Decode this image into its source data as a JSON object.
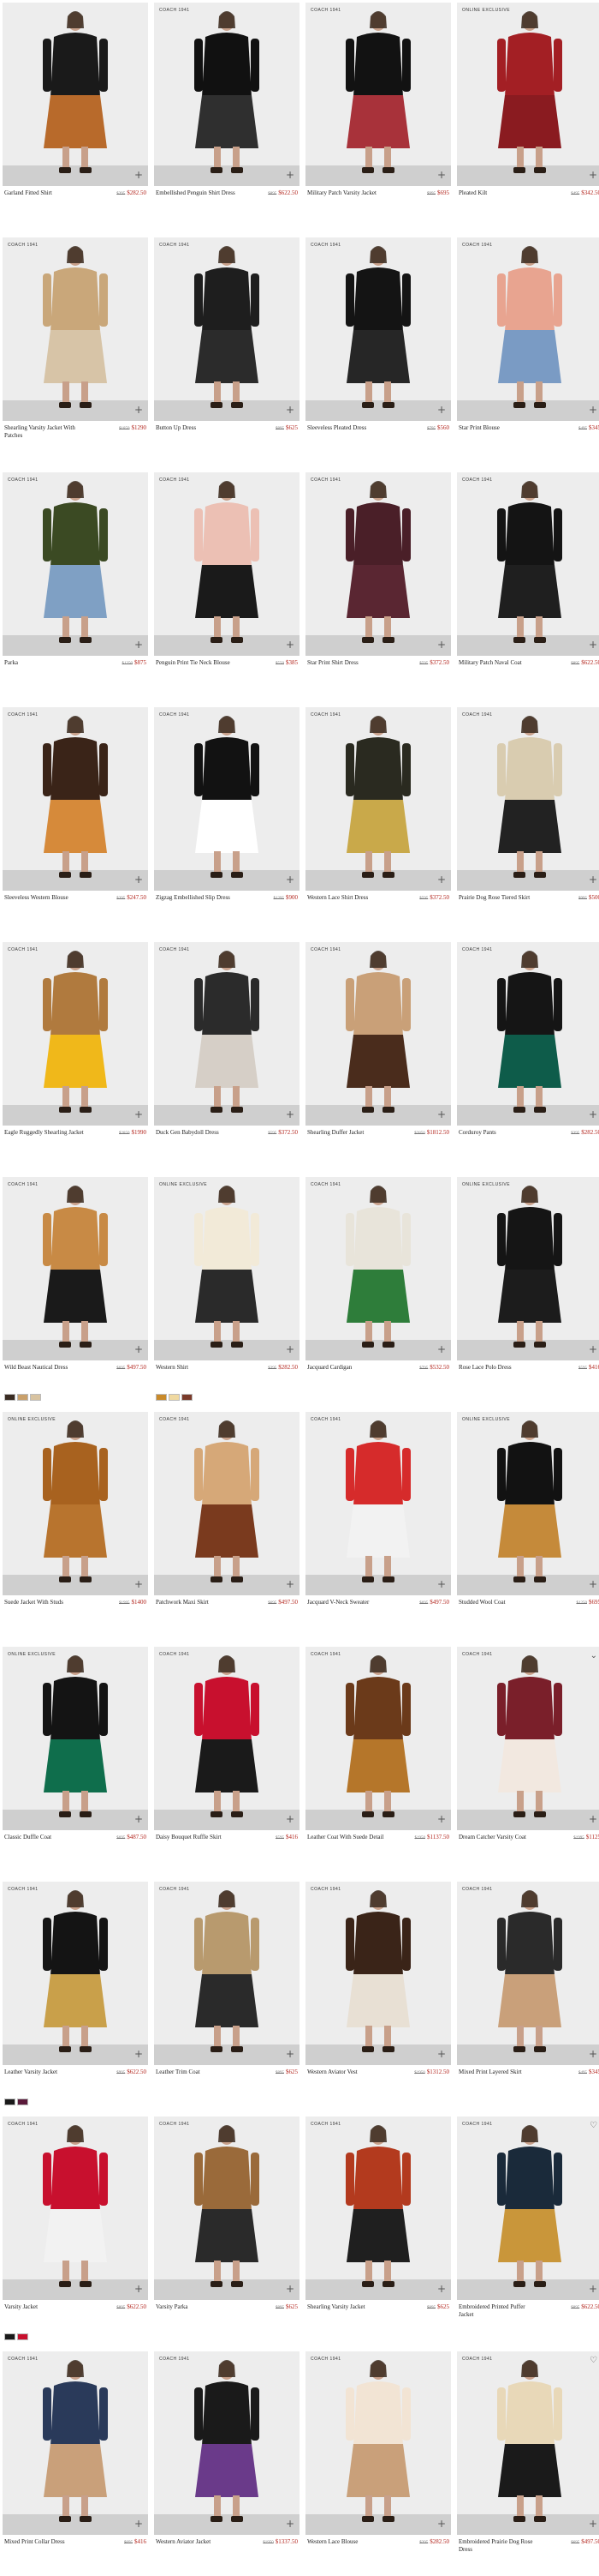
{
  "colors": {
    "sale_price": "#b3261e",
    "image_background": "#ededed",
    "floor": "#cfcfcf"
  },
  "products": [
    {
      "tag": "",
      "name": "Garland Fitted Shirt",
      "was": "$395",
      "now": "$282.50",
      "colors": [
        "#1a1a1a",
        "#b86a2b"
      ],
      "swatches": []
    },
    {
      "tag": "COACH 1941",
      "name": "Embellished Penguin Shirt Dress",
      "was": "$895",
      "now": "$622.50",
      "colors": [
        "#111111",
        "#2f2f2f"
      ],
      "swatches": []
    },
    {
      "tag": "COACH 1941",
      "name": "Military Patch Varsity Jacket",
      "was": "$995",
      "now": "$695",
      "colors": [
        "#121212",
        "#a8323a"
      ],
      "swatches": []
    },
    {
      "tag": "ONLINE EXCLUSIVE",
      "name": "Pleated Kilt",
      "was": "$495",
      "now": "$342.50",
      "colors": [
        "#a31f24",
        "#8a1b20"
      ],
      "swatches": []
    },
    {
      "tag": "COACH 1941",
      "name": "Shearling Varsity Jacket With Patches",
      "was": "$1850",
      "now": "$1290",
      "colors": [
        "#c9a77a",
        "#d7c4a7"
      ],
      "swatches": []
    },
    {
      "tag": "COACH 1941",
      "name": "Button Up Dress",
      "was": "$895",
      "now": "$625",
      "colors": [
        "#1e1e1e",
        "#2b2b2b"
      ],
      "swatches": []
    },
    {
      "tag": "COACH 1941",
      "name": "Sleeveless Pleated Dress",
      "was": "$795",
      "now": "$560",
      "colors": [
        "#141414",
        "#262626"
      ],
      "swatches": []
    },
    {
      "tag": "COACH 1941",
      "name": "Star Print Blouse",
      "was": "$495",
      "now": "$345",
      "colors": [
        "#e8a490",
        "#7a9bc4"
      ],
      "swatches": []
    },
    {
      "tag": "COACH 1941",
      "name": "Parka",
      "was": "$1250",
      "now": "$875",
      "colors": [
        "#3b4a23",
        "#7fa0c4"
      ],
      "swatches": []
    },
    {
      "tag": "COACH 1941",
      "name": "Penguin Print Tie Neck Blouse",
      "was": "$550",
      "now": "$385",
      "colors": [
        "#ecc0b4",
        "#1a1a1a"
      ],
      "swatches": []
    },
    {
      "tag": "COACH 1941",
      "name": "Star Print Shirt Dress",
      "was": "$595",
      "now": "$372.50",
      "colors": [
        "#4a1f28",
        "#5a2632"
      ],
      "swatches": []
    },
    {
      "tag": "COACH 1941",
      "name": "Military Patch Naval Coat",
      "was": "$895",
      "now": "$622.50",
      "colors": [
        "#141414",
        "#1f1f1f"
      ],
      "swatches": []
    },
    {
      "tag": "COACH 1941",
      "name": "Sleeveless Western Blouse",
      "was": "$395",
      "now": "$247.50",
      "colors": [
        "#3a2418",
        "#d68a3a"
      ],
      "swatches": []
    },
    {
      "tag": "COACH 1941",
      "name": "Zigzag Embellished Slip Dress",
      "was": "$1295",
      "now": "$900",
      "colors": [
        "#121212",
        "#ffffff"
      ],
      "swatches": []
    },
    {
      "tag": "COACH 1941",
      "name": "Western Lace Shirt Dress",
      "was": "$595",
      "now": "$372.50",
      "colors": [
        "#2a2a20",
        "#c9a94a"
      ],
      "swatches": []
    },
    {
      "tag": "COACH 1941",
      "name": "Prairie Dog Rose Tiered Skirt",
      "was": "$995",
      "now": "$500",
      "colors": [
        "#d9ccb0",
        "#222222"
      ],
      "swatches": []
    },
    {
      "tag": "COACH 1941",
      "name": "Eagle Ruggedly Shearling Jacket",
      "was": "$2850",
      "now": "$1990",
      "colors": [
        "#b07a3e",
        "#f0b81a"
      ],
      "swatches": []
    },
    {
      "tag": "COACH 1941",
      "name": "Duck Gen Babydoll Dress",
      "was": "$595",
      "now": "$372.50",
      "colors": [
        "#2b2b2b",
        "#d6cfc7"
      ],
      "swatches": []
    },
    {
      "tag": "COACH 1941",
      "name": "Shearling Duffer Jacket",
      "was": "$2850",
      "now": "$1812.50",
      "colors": [
        "#c9a078",
        "#4a2c1c"
      ],
      "swatches": []
    },
    {
      "tag": "COACH 1941",
      "name": "Corduroy Pants",
      "was": "$395",
      "now": "$282.50",
      "colors": [
        "#151515",
        "#0e5c4a"
      ],
      "swatches": []
    },
    {
      "tag": "COACH 1941",
      "name": "Wild Beast Nautical Dress",
      "was": "$695",
      "now": "$497.50",
      "colors": [
        "#c88a45",
        "#1a1a1a"
      ],
      "swatches": [
        "#3a2c22",
        "#c9a06a",
        "#d8c3a0"
      ]
    },
    {
      "tag": "ONLINE EXCLUSIVE",
      "name": "Western Shirt",
      "was": "$395",
      "now": "$282.50",
      "colors": [
        "#f2ead8",
        "#2a2a2a"
      ],
      "swatches": [
        "#c98a2a",
        "#f0d9a0",
        "#7a3a2a"
      ]
    },
    {
      "tag": "COACH 1941",
      "name": "Jacquard Cardigan",
      "was": "$795",
      "now": "$532.50",
      "colors": [
        "#e8e4da",
        "#2e7d3a"
      ],
      "swatches": []
    },
    {
      "tag": "ONLINE EXCLUSIVE",
      "name": "Rose Lace Polo Dress",
      "was": "$595",
      "now": "$416",
      "colors": [
        "#151515",
        "#1c1c1c"
      ],
      "swatches": []
    },
    {
      "tag": "ONLINE EXCLUSIVE",
      "name": "Suede Jacket With Studs",
      "was": "$1995",
      "now": "$1400",
      "colors": [
        "#a8621f",
        "#b8742e"
      ],
      "swatches": []
    },
    {
      "tag": "COACH 1941",
      "name": "Patchwork Maxi Skirt",
      "was": "$695",
      "now": "$497.50",
      "colors": [
        "#d6a878",
        "#7a3a1e"
      ],
      "swatches": []
    },
    {
      "tag": "COACH 1941",
      "name": "Jacquard V-Neck Sweater",
      "was": "$695",
      "now": "$497.50",
      "colors": [
        "#d62b2b",
        "#f2f2f2"
      ],
      "swatches": []
    },
    {
      "tag": "ONLINE EXCLUSIVE",
      "name": "Studded Wool Coat",
      "was": "$1250",
      "now": "$695",
      "colors": [
        "#121212",
        "#c58a3a"
      ],
      "swatches": []
    },
    {
      "tag": "ONLINE EXCLUSIVE",
      "name": "Classic Duffle Coat",
      "was": "$695",
      "now": "$487.50",
      "colors": [
        "#141414",
        "#0f6e4c"
      ],
      "swatches": []
    },
    {
      "tag": "COACH 1941",
      "name": "Daisy Bouquet Ruffle Skirt",
      "was": "$595",
      "now": "$416",
      "colors": [
        "#c8102e",
        "#1a1a1a"
      ],
      "swatches": []
    },
    {
      "tag": "COACH 1941",
      "name": "Leather Coat With Suede Detail",
      "was": "$1950",
      "now": "$1137.50",
      "colors": [
        "#6b3a1a",
        "#b5762a"
      ],
      "swatches": []
    },
    {
      "tag": "COACH 1941",
      "name": "Dream Catcher Varsity Coat",
      "was": "$1995",
      "now": "$1125",
      "colors": [
        "#7a1f2a",
        "#f2e8e0"
      ],
      "swatches": []
    },
    {
      "tag": "COACH 1941",
      "name": "Leather Varsity Jacket",
      "was": "$995",
      "now": "$622.50",
      "colors": [
        "#141414",
        "#c9a04a"
      ],
      "swatches": [
        "#1a1a1a",
        "#5a1a3a"
      ]
    },
    {
      "tag": "COACH 1941",
      "name": "Leather Trim Coat",
      "was": "$895",
      "now": "$625",
      "colors": [
        "#b89a6e",
        "#2a2a2a"
      ],
      "swatches": []
    },
    {
      "tag": "COACH 1941",
      "name": "Western Aviator Vest",
      "was": "$1950",
      "now": "$1312.50",
      "colors": [
        "#3a2418",
        "#e8e0d4"
      ],
      "swatches": []
    },
    {
      "tag": "COACH 1941",
      "name": "Mixed Print Layered Skirt",
      "was": "$495",
      "now": "$345",
      "colors": [
        "#2a2a2a",
        "#c9a07a"
      ],
      "swatches": []
    },
    {
      "tag": "COACH 1941",
      "name": "Varsity Jacket",
      "was": "$895",
      "now": "$622.50",
      "colors": [
        "#c8102e",
        "#f2f2f2"
      ],
      "swatches": [
        "#1a1a1a",
        "#c8102e"
      ]
    },
    {
      "tag": "COACH 1941",
      "name": "Varsity Parka",
      "was": "$895",
      "now": "$625",
      "colors": [
        "#9a6a3a",
        "#2a2a2a"
      ],
      "swatches": []
    },
    {
      "tag": "COACH 1941",
      "name": "Shearling Varsity Jacket",
      "was": "$895",
      "now": "$625",
      "colors": [
        "#b33a1e",
        "#1f1f1f"
      ],
      "swatches": []
    },
    {
      "tag": "COACH 1941",
      "name": "Embroidered Printed Puffer Jacket",
      "was": "$895",
      "now": "$622.50",
      "colors": [
        "#1a2a3a",
        "#c9963a"
      ],
      "swatches": []
    },
    {
      "tag": "COACH 1941",
      "name": "Mixed Print Collar Dress",
      "was": "$695",
      "now": "$416",
      "colors": [
        "#2a3a5a",
        "#c9a07a"
      ],
      "swatches": []
    },
    {
      "tag": "COACH 1941",
      "name": "Western Aviator Jacket",
      "was": "$1950",
      "now": "$1337.50",
      "colors": [
        "#1a1a1a",
        "#6a3a8a"
      ],
      "swatches": []
    },
    {
      "tag": "COACH 1941",
      "name": "Western Lace Blouse",
      "was": "$395",
      "now": "$282.50",
      "colors": [
        "#f2e4d4",
        "#c9a07a"
      ],
      "swatches": []
    },
    {
      "tag": "COACH 1941",
      "name": "Embroidered Prairie Dog Rose Dress",
      "was": "$695",
      "now": "$497.50",
      "colors": [
        "#e8d8b8",
        "#1a1a1a"
      ],
      "swatches": []
    }
  ],
  "icons": {
    "add": "+",
    "heart": "♡",
    "chevron": "⌄"
  },
  "corner_icons": {
    "31": "chevron",
    "39": "heart",
    "43": "heart"
  }
}
